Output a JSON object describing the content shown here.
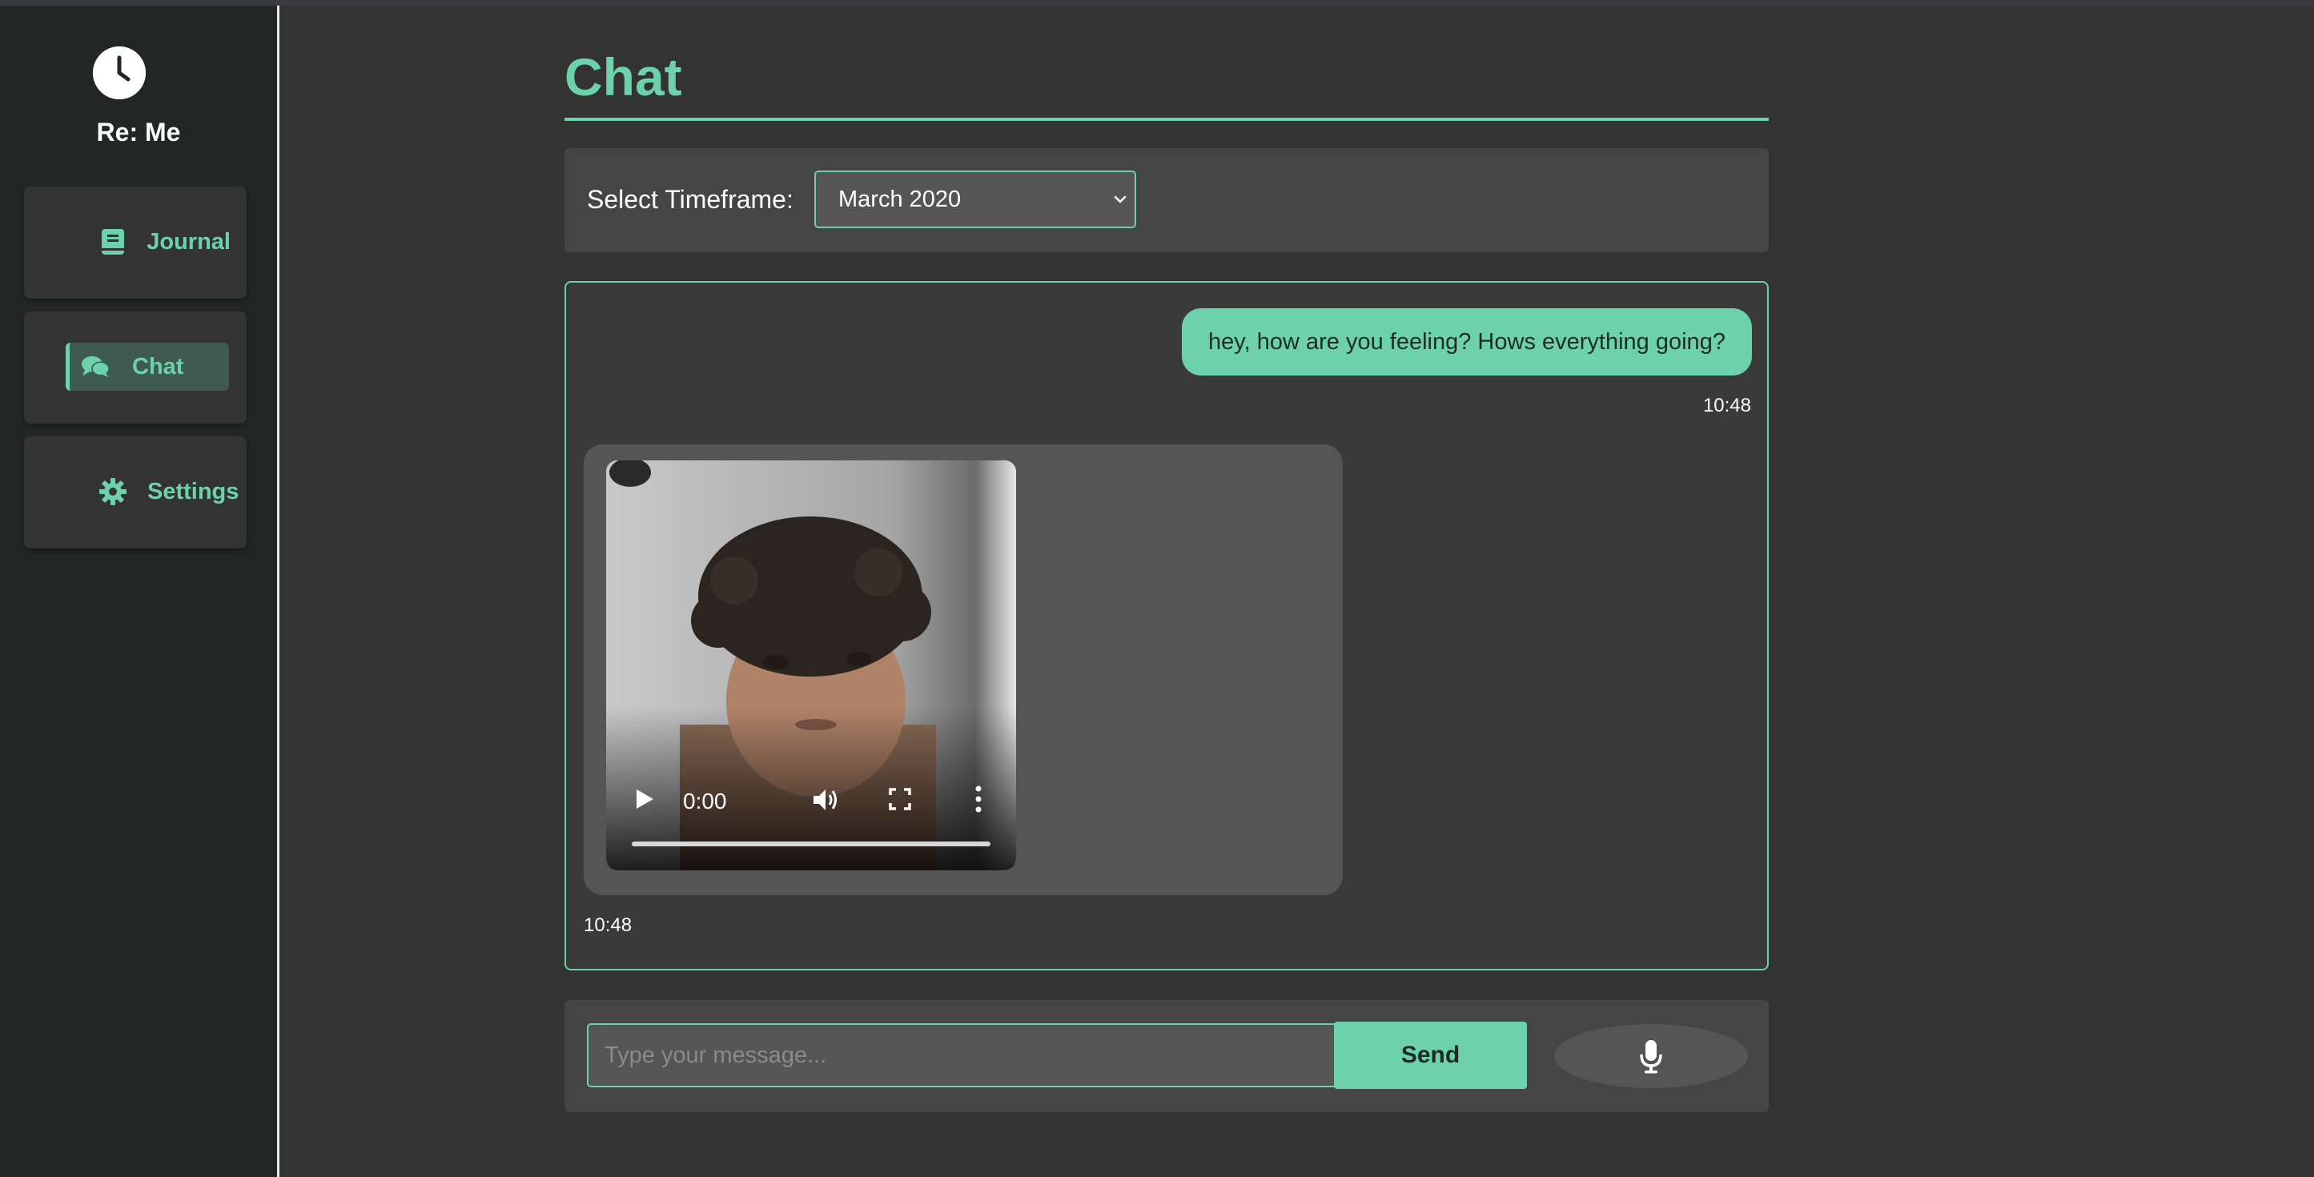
{
  "app": {
    "name": "Re: Me",
    "accent_color": "#6dd2ab",
    "logo_icon": "clock-icon"
  },
  "sidebar": {
    "items": [
      {
        "label": "Journal",
        "icon": "book-icon",
        "active": false
      },
      {
        "label": "Chat",
        "icon": "comments-icon",
        "active": true
      },
      {
        "label": "Settings",
        "icon": "gear-icon",
        "active": false
      }
    ]
  },
  "main": {
    "title": "Chat",
    "timeframe": {
      "label": "Select Timeframe:",
      "selected": "March 2020"
    },
    "messages": [
      {
        "sender": "user",
        "text": "hey, how are you feeling? Hows everything going?",
        "time": "10:48"
      },
      {
        "sender": "bot",
        "type": "video",
        "video_time": "0:00",
        "time": "10:48"
      }
    ],
    "composer": {
      "placeholder": "Type your message...",
      "send_label": "Send",
      "mic_icon": "microphone-icon"
    }
  }
}
